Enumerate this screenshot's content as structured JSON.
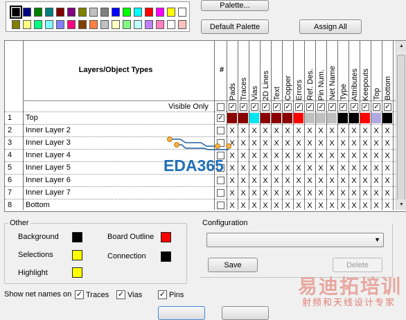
{
  "palette": {
    "colors_row1": [
      "#000000",
      "#000080",
      "#008000",
      "#008080",
      "#800000",
      "#800080",
      "#808000",
      "#c0c0c0",
      "#808080",
      "#0000ff",
      "#00ff00",
      "#00ffff",
      "#ff0000",
      "#ff00ff",
      "#ffff00",
      "#ffffff"
    ],
    "colors_row2": [
      "#808000",
      "#ffff80",
      "#00ff80",
      "#80ffff",
      "#8080ff",
      "#ff0080",
      "#804000",
      "#ff8040",
      "#c0c0c0",
      "#ffffc0",
      "#80ff80",
      "#c0ffff",
      "#c080ff",
      "#ff80c0",
      "#ffffff",
      "#ffc0c0"
    ],
    "selected_index": 0
  },
  "buttons": {
    "palette": "Palette...",
    "default_palette": "Default Palette",
    "assign_all": "Assign All",
    "save": "Save",
    "delete": "Delete"
  },
  "grid": {
    "header_title": "Layers/Object Types",
    "number_header": "#",
    "visible_only": "Visible Only",
    "columns": [
      "Pads",
      "Traces",
      "Vias",
      "2D Lines",
      "Text",
      "Copper",
      "Errors",
      "Ref. Des.",
      "Pin Num.",
      "Net Name",
      "Type",
      "Attributes",
      "Keepouts",
      "Top",
      "Bottom"
    ],
    "header_checks": [
      true,
      true,
      true,
      true,
      true,
      true,
      true,
      true,
      true,
      true,
      true,
      true,
      true,
      true,
      true
    ],
    "layers": [
      {
        "num": "1",
        "name": "Top",
        "checked": true,
        "colors": [
          "#8b0000",
          "#8b0000",
          "#00e5ee",
          "#8b0000",
          "#8b0000",
          "#8b0000",
          "#ff0000",
          "#c0c0c0",
          "#c0c0c0",
          "#c0c0c0",
          "#000000",
          "#000000",
          "#ff0000",
          "#b0a8e0",
          "#000000"
        ]
      },
      {
        "num": "2",
        "name": "Inner Layer 2",
        "checked": false
      },
      {
        "num": "3",
        "name": "Inner Layer 3",
        "checked": false
      },
      {
        "num": "4",
        "name": "Inner Layer 4",
        "checked": false
      },
      {
        "num": "5",
        "name": "Inner Layer 5",
        "checked": false
      },
      {
        "num": "6",
        "name": "Inner Layer 6",
        "checked": false
      },
      {
        "num": "7",
        "name": "Inner Layer 7",
        "checked": false
      },
      {
        "num": "8",
        "name": "Bottom",
        "checked": false
      }
    ],
    "x_mark": "X"
  },
  "other": {
    "legend": "Other",
    "background": {
      "label": "Background",
      "color": "#000000"
    },
    "selections": {
      "label": "Selections",
      "color": "#ffff00"
    },
    "highlight": {
      "label": "Highlight",
      "color": "#ffff00"
    },
    "board_outline": {
      "label": "Board Outline",
      "color": "#ff0000"
    },
    "connection": {
      "label": "Connection",
      "color": "#000000"
    }
  },
  "configuration": {
    "legend": "Configuration",
    "selected_value": ""
  },
  "net_names": {
    "label": "Show net names on",
    "options": [
      {
        "label": "Traces",
        "checked": true
      },
      {
        "label": "Vias",
        "checked": true
      },
      {
        "label": "Pins",
        "checked": true
      }
    ]
  },
  "watermarks": {
    "eda": "EDA365",
    "cn_main": "易迪拓培训",
    "cn_sub": "射频和天线设计专家"
  }
}
